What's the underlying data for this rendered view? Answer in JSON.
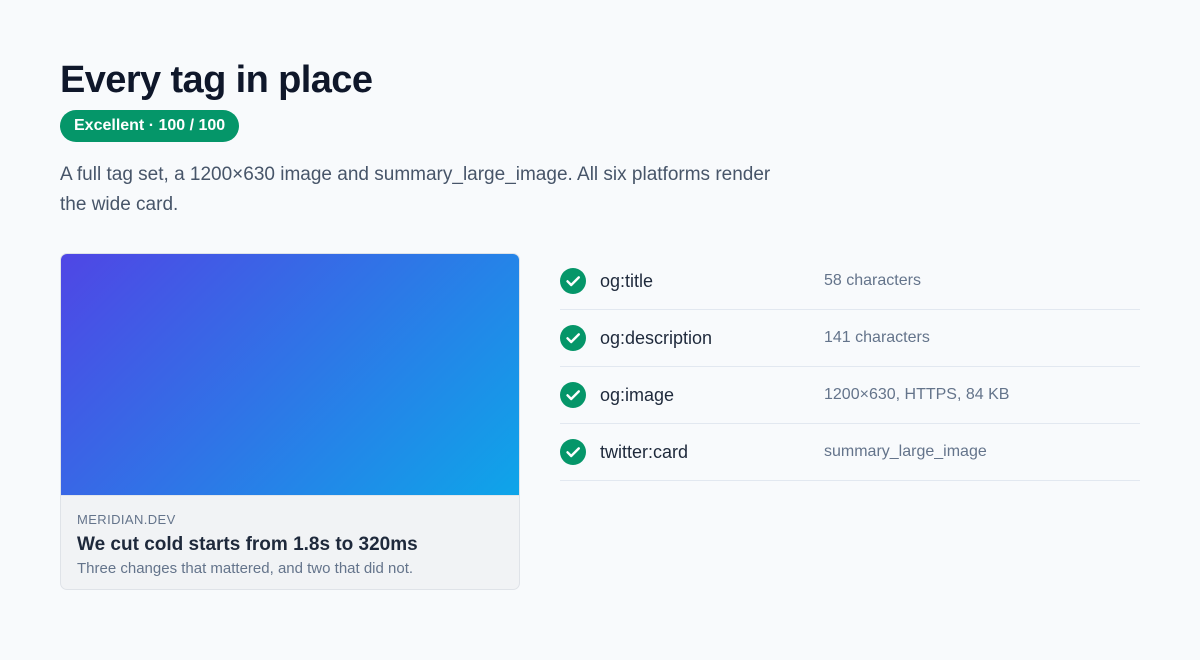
{
  "header": {
    "title": "Every tag in place",
    "badge": "Excellent · 100 / 100",
    "description": "A full tag set, a 1200×630 image and summary_large_image. All six platforms render the wide card."
  },
  "preview_card": {
    "domain": "MERIDIAN.DEV",
    "title": "We cut cold starts from 1.8s to 320ms",
    "description": "Three changes that mattered, and two that did not."
  },
  "checks": [
    {
      "name": "og:title",
      "detail": "58 characters",
      "icon": "check-icon"
    },
    {
      "name": "og:description",
      "detail": "141 characters",
      "icon": "check-icon"
    },
    {
      "name": "og:image",
      "detail": "1200×630, HTTPS, 84 KB",
      "icon": "check-icon"
    },
    {
      "name": "twitter:card",
      "detail": "summary_large_image",
      "icon": "check-icon"
    }
  ],
  "colors": {
    "background": "#f8fafc",
    "success": "#059669",
    "gradient_start": "#4f46e5",
    "gradient_end": "#0ea5e9"
  }
}
